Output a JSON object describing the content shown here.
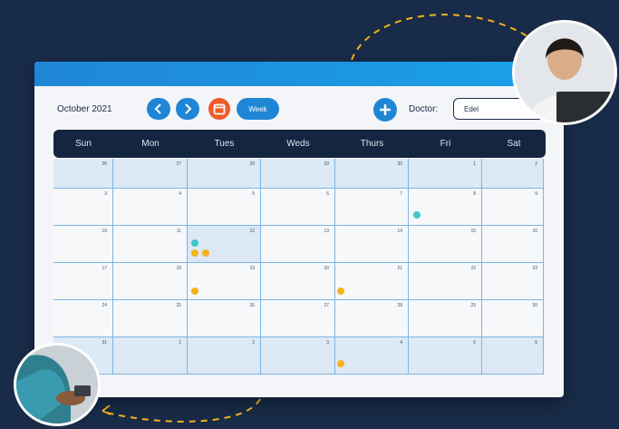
{
  "toolbar": {
    "month": "October 2021",
    "week_label": "Week",
    "doctor_label": "Doctor:",
    "doctor_value": "Edel"
  },
  "days": [
    "Sun",
    "Mon",
    "Tues",
    "Weds",
    "Thurs",
    "Fri",
    "Sat"
  ],
  "weeks": [
    [
      "26",
      "27",
      "28",
      "29",
      "30",
      "1",
      "2"
    ],
    [
      "3",
      "4",
      "5",
      "6",
      "7",
      "8",
      "9"
    ],
    [
      "10",
      "11",
      "12",
      "13",
      "14",
      "15",
      "16"
    ],
    [
      "17",
      "18",
      "19",
      "20",
      "21",
      "22",
      "23"
    ],
    [
      "24",
      "25",
      "26",
      "27",
      "28",
      "29",
      "30"
    ],
    [
      "31",
      "1",
      "2",
      "3",
      "4",
      "5",
      "6"
    ]
  ],
  "events": [
    {
      "date": "Oct 8",
      "color": "#3cc8c8"
    },
    {
      "date": "Oct 12",
      "color": "#3cc8c8"
    },
    {
      "date": "Oct 12",
      "color": "#f5b21e"
    },
    {
      "date": "Oct 12",
      "color": "#f5b21e"
    },
    {
      "date": "Oct 19",
      "color": "#f5b21e"
    },
    {
      "date": "Oct 21",
      "color": "#f5b21e"
    },
    {
      "date": "Nov 4",
      "color": "#f5b21e"
    }
  ],
  "colors": {
    "accent": "#1f86d6",
    "calendar_button": "#f05a28",
    "header_bg": "#132540",
    "page_bg": "#182b48"
  },
  "icons": [
    "chevron-left-icon",
    "chevron-right-icon",
    "calendar-icon",
    "plus-icon",
    "woman-laptop-avatar",
    "man-phone-avatar"
  ]
}
